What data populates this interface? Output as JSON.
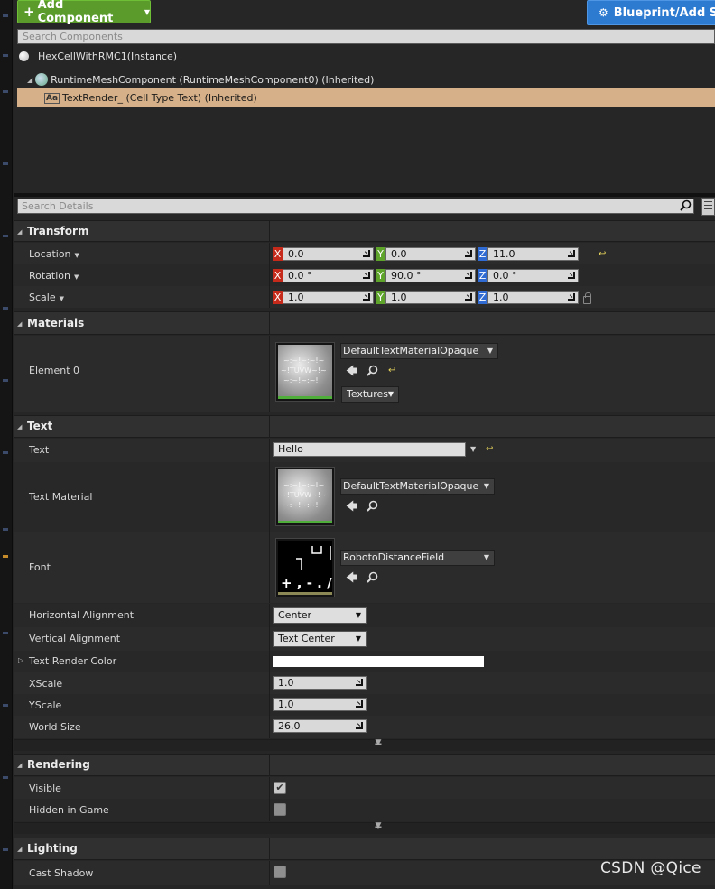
{
  "toolbar": {
    "add_component_label": "Add Component",
    "blueprint_label": "Blueprint/Add S"
  },
  "components": {
    "search_placeholder": "Search Components",
    "instance": "HexCellWithRMC1(Instance)",
    "items": [
      {
        "label": "RuntimeMeshComponent (RuntimeMeshComponent0) (Inherited)",
        "icon": "mesh-component-icon"
      },
      {
        "label": "TextRender_ (Cell Type Text) (Inherited)",
        "icon": "text-render-icon",
        "selected": true
      }
    ]
  },
  "details": {
    "search_placeholder": "Search Details",
    "transform": {
      "title": "Transform",
      "location": {
        "label": "Location",
        "x": "0.0",
        "y": "0.0",
        "z": "11.0"
      },
      "rotation": {
        "label": "Rotation",
        "x": "0.0 °",
        "y": "90.0 °",
        "z": "0.0 °"
      },
      "scale": {
        "label": "Scale",
        "x": "1.0",
        "y": "1.0",
        "z": "1.0"
      },
      "axis_labels": [
        "X",
        "Y",
        "Z"
      ]
    },
    "materials": {
      "title": "Materials",
      "element0": {
        "label": "Element 0",
        "asset": "DefaultTextMaterialOpaque",
        "textures_label": "Textures"
      }
    },
    "text": {
      "title": "Text",
      "text": {
        "label": "Text",
        "value": "Hello"
      },
      "text_material": {
        "label": "Text Material",
        "asset": "DefaultTextMaterialOpaque"
      },
      "font": {
        "label": "Font",
        "asset": "RobotoDistanceField",
        "preview_glyphs": "+ , - . /"
      },
      "horizontal_alignment": {
        "label": "Horizontal Alignment",
        "value": "Center"
      },
      "vertical_alignment": {
        "label": "Vertical Alignment",
        "value": "Text Center"
      },
      "text_render_color": {
        "label": "Text Render Color",
        "color": "#ffffff"
      },
      "xscale": {
        "label": "XScale",
        "value": "1.0"
      },
      "yscale": {
        "label": "YScale",
        "value": "1.0"
      },
      "world_size": {
        "label": "World Size",
        "value": "26.0"
      }
    },
    "rendering": {
      "title": "Rendering",
      "visible": {
        "label": "Visible",
        "checked": true
      },
      "hidden_in_game": {
        "label": "Hidden in Game",
        "checked": false
      }
    },
    "lighting": {
      "title": "Lighting",
      "cast_shadow": {
        "label": "Cast Shadow",
        "checked": false
      }
    }
  },
  "watermark": "CSDN @Qice",
  "colors": {
    "add_component": "#5a9b2c",
    "blueprint": "#2d7bd1",
    "selected_row": "#d6b088",
    "axis_x": "#c52a1a",
    "axis_y": "#5ea32a",
    "axis_z": "#2f6bd2"
  }
}
